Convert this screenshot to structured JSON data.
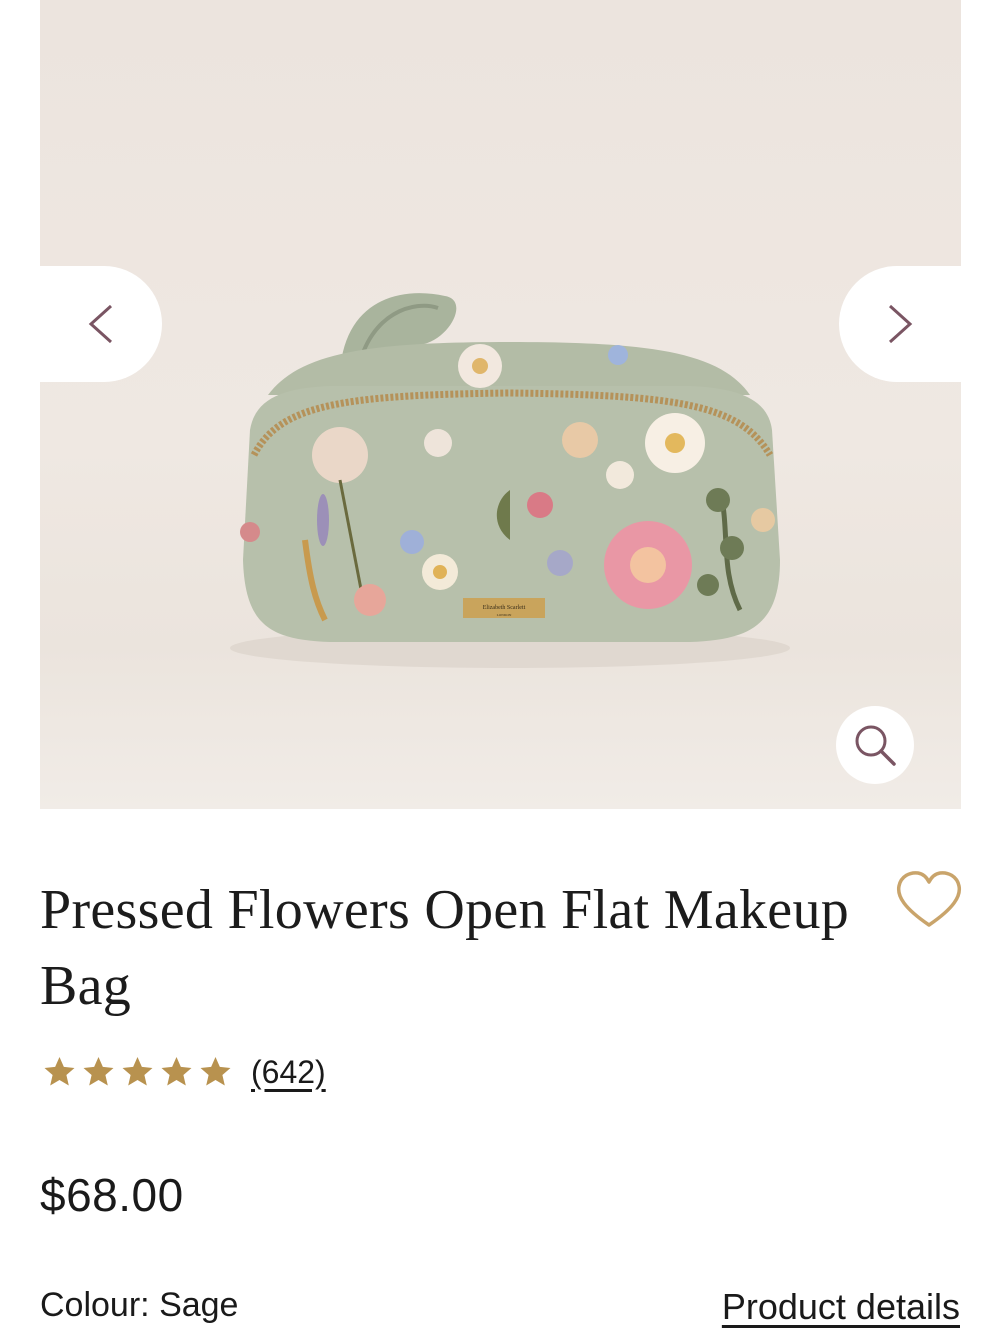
{
  "product": {
    "image": {
      "alt": "Pressed Flowers Open Flat Makeup Bag",
      "brand_plate_text": "Elizabeth Scarlett",
      "brand_plate_subtext": "LONDON"
    },
    "title": "Pressed Flowers Open Flat Makeup Bag",
    "rating": {
      "stars": 5,
      "review_count_label": "(642)"
    },
    "price": "$68.00",
    "colour": {
      "label": "Colour:",
      "value": "Sage"
    },
    "product_details_label": "Product details"
  },
  "icons": {
    "prev": "chevron-left-icon",
    "next": "chevron-right-icon",
    "zoom": "search-icon",
    "wishlist": "heart-icon",
    "star": "star-icon"
  },
  "colors": {
    "chevron": "#7a5563",
    "heart": "#c9a46b",
    "star": "#b8924f",
    "bag": "#b7c0ab"
  }
}
